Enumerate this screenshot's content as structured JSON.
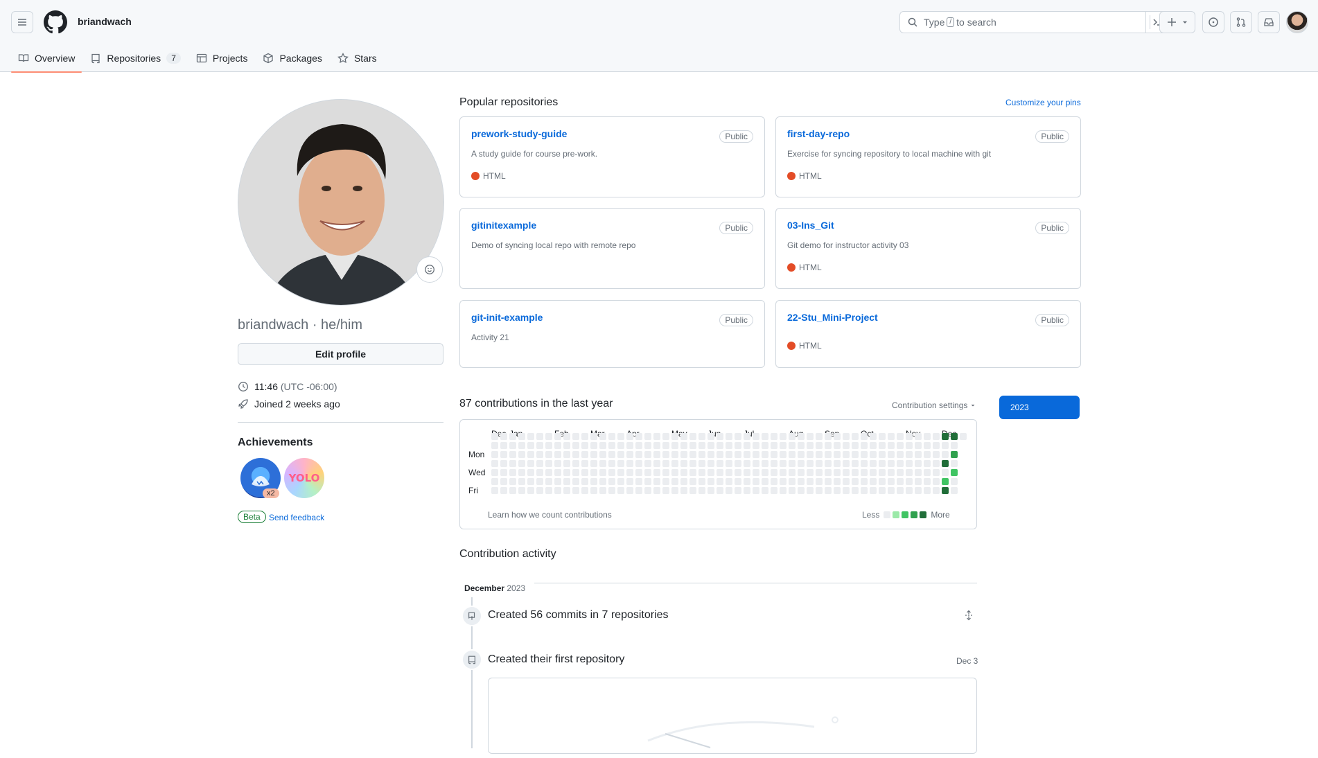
{
  "header": {
    "username": "briandwach",
    "search_prefix": "Type",
    "search_key": "/",
    "search_suffix": "to search"
  },
  "tabs": [
    {
      "label": "Overview"
    },
    {
      "label": "Repositories",
      "count": "7"
    },
    {
      "label": "Projects"
    },
    {
      "label": "Packages"
    },
    {
      "label": "Stars"
    }
  ],
  "profile": {
    "name": "briandwach · he/him",
    "edit_label": "Edit profile",
    "time": "11:46",
    "timezone": "(UTC -06:00)",
    "joined": "Joined 2 weeks ago",
    "achievements_title": "Achievements",
    "badge_count": "x2",
    "beta_label": "Beta",
    "feedback_label": "Send feedback"
  },
  "popular": {
    "title": "Popular repositories",
    "customize_label": "Customize your pins",
    "repos": [
      {
        "name": "prework-study-guide",
        "visibility": "Public",
        "description": "A study guide for course pre-work.",
        "language": "HTML"
      },
      {
        "name": "first-day-repo",
        "visibility": "Public",
        "description": "Exercise for syncing repository to local machine with git",
        "language": "HTML"
      },
      {
        "name": "gitinitexample",
        "visibility": "Public",
        "description": "Demo of syncing local repo with remote repo",
        "language": ""
      },
      {
        "name": "03-Ins_Git",
        "visibility": "Public",
        "description": "Git demo for instructor activity 03",
        "language": "HTML"
      },
      {
        "name": "git-init-example",
        "visibility": "Public",
        "description": "Activity 21",
        "language": ""
      },
      {
        "name": "22-Stu_Mini-Project",
        "visibility": "Public",
        "description": "",
        "language": "HTML"
      }
    ]
  },
  "contributions": {
    "title": "87 contributions in the last year",
    "settings_label": "Contribution settings",
    "year": "2023",
    "months": [
      "Dec",
      "Jan",
      "Feb",
      "Mar",
      "Apr",
      "May",
      "Jun",
      "Jul",
      "Aug",
      "Sep",
      "Oct",
      "Nov",
      "Dec"
    ],
    "days": [
      "Mon",
      "Wed",
      "Fri"
    ],
    "learn_label": "Learn how we count contributions",
    "less_label": "Less",
    "more_label": "More",
    "colors": [
      "#ebedf0",
      "#9be9a8",
      "#40c463",
      "#30a14e",
      "#216e39"
    ]
  },
  "activity": {
    "title": "Contribution activity",
    "month": "December",
    "year": "2023",
    "item1": "Created 56 commits in 7 repositories",
    "item2": "Created their first repository",
    "item2_date": "Dec 3"
  }
}
